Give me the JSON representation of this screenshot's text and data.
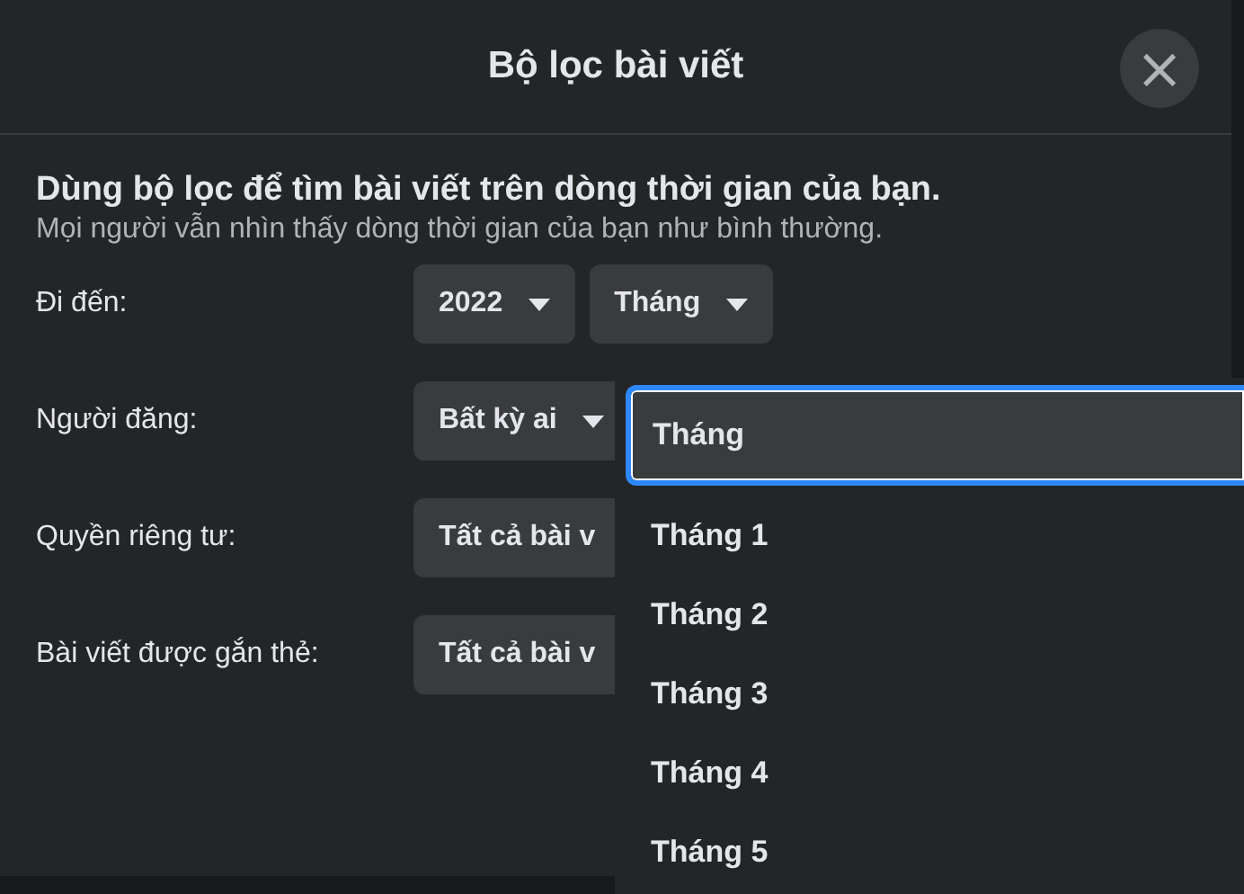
{
  "dialog": {
    "title": "Bộ lọc bài viết",
    "close": "×"
  },
  "intro": {
    "heading": "Dùng bộ lọc để tìm bài viết trên dòng thời gian của bạn.",
    "subtext": "Mọi người vẫn nhìn thấy dòng thời gian của bạn như bình thường."
  },
  "filters": [
    {
      "label": "Đi đến:",
      "controls": [
        "2022",
        "Tháng"
      ]
    },
    {
      "label": "Người đăng:",
      "controls": [
        "Bất kỳ ai"
      ]
    },
    {
      "label": "Quyền riêng tư:",
      "controls": [
        "Tất cả bài v"
      ]
    },
    {
      "label": "Bài viết được gắn thẻ:",
      "controls": [
        "Tất cả bài v"
      ]
    }
  ],
  "month_menu": [
    {
      "label": "Tháng",
      "selected": true
    },
    {
      "label": "Tháng 1",
      "selected": false
    },
    {
      "label": "Tháng 2",
      "selected": false
    },
    {
      "label": "Tháng 3",
      "selected": false
    },
    {
      "label": "Tháng 4",
      "selected": false
    },
    {
      "label": "Tháng 5",
      "selected": false
    }
  ]
}
